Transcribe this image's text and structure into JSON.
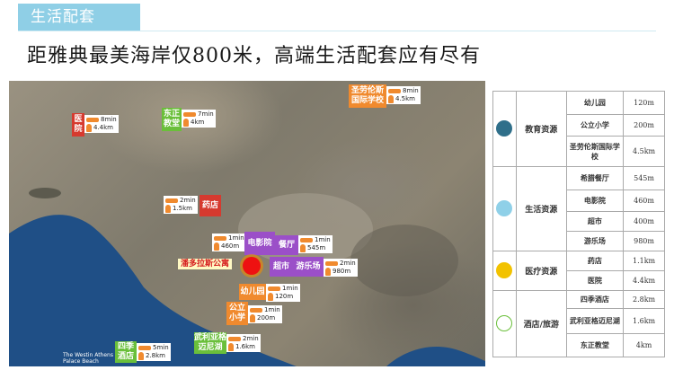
{
  "header": {
    "tab_label": "生活配套",
    "headline": "距雅典最美海岸仅800米，高端生活配套应有尽有"
  },
  "map": {
    "project_label": "潘多拉斯公寓",
    "caption_line1": "The Westin Athens",
    "caption_line2": "Palace Beach",
    "pins": [
      {
        "id": "hospital",
        "label": "医院",
        "color": "#d63a2f",
        "drive": "8min",
        "walk": "4.4km"
      },
      {
        "id": "dongzheng",
        "label": "东正教堂",
        "color": "#6abf3a",
        "drive": "7min",
        "walk": "4km"
      },
      {
        "id": "st-lawrence",
        "label": "圣劳伦斯国际学校",
        "color": "#f08a2e",
        "drive": "8min",
        "walk": "4.5km"
      },
      {
        "id": "pharmacy",
        "label": "药店",
        "color": "#d63a2f",
        "drive": "2min",
        "walk": "1.5km"
      },
      {
        "id": "cinema",
        "label": "电影院",
        "color": "#9b4fc8",
        "drive": "1min",
        "walk": "460m"
      },
      {
        "id": "restaurant",
        "label": "餐厅",
        "color": "#9b4fc8",
        "drive": "1min",
        "walk": "545m"
      },
      {
        "id": "supermarket",
        "label": "超市",
        "color": "#9b4fc8",
        "drive": "",
        "walk": ""
      },
      {
        "id": "playground",
        "label": "游乐场",
        "color": "#9b4fc8",
        "drive": "2min",
        "walk": "980m"
      },
      {
        "id": "kindergarten",
        "label": "幼儿园",
        "color": "#f08a2e",
        "drive": "1min",
        "walk": "120m"
      },
      {
        "id": "primary",
        "label": "公立小学",
        "color": "#f08a2e",
        "drive": "1min",
        "walk": "200m"
      },
      {
        "id": "vouliagmeni",
        "label": "武利亚格迈尼湖",
        "color": "#6abf3a",
        "drive": "2min",
        "walk": "1.6km"
      },
      {
        "id": "four-seasons",
        "label": "四季酒店",
        "color": "#6abf3a",
        "drive": "5min",
        "walk": "2.8km"
      }
    ]
  },
  "table": {
    "groups": [
      {
        "category": "教育资源",
        "icon": "school-icon",
        "items": [
          {
            "name": "幼儿园",
            "distance": "120m"
          },
          {
            "name": "公立小学",
            "distance": "200m"
          },
          {
            "name": "圣劳伦斯国际学校",
            "distance": "4.5km"
          }
        ]
      },
      {
        "category": "生活资源",
        "icon": "shopping-icon",
        "items": [
          {
            "name": "希腊餐厅",
            "distance": "545m"
          },
          {
            "name": "电影院",
            "distance": "460m"
          },
          {
            "name": "超市",
            "distance": "400m"
          },
          {
            "name": "游乐场",
            "distance": "980m"
          }
        ]
      },
      {
        "category": "医疗资源",
        "icon": "medical-icon",
        "items": [
          {
            "name": "药店",
            "distance": "1.1km"
          },
          {
            "name": "医院",
            "distance": "4.4km"
          }
        ]
      },
      {
        "category": "酒店/旅游",
        "icon": "hotel-icon",
        "items": [
          {
            "name": "四季酒店",
            "distance": "2.8km"
          },
          {
            "name": "武利亚格迈尼湖",
            "distance": "1.6km"
          },
          {
            "name": "东正教堂",
            "distance": "4km"
          }
        ]
      }
    ]
  }
}
